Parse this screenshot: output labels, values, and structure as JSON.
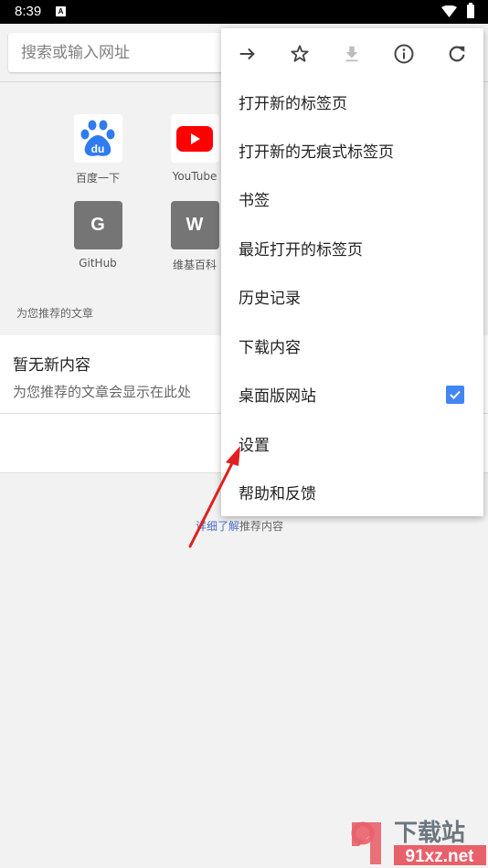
{
  "status_bar": {
    "time": "8:39",
    "notification_icon": "A",
    "icons": [
      "wifi-icon",
      "battery-charging-icon"
    ]
  },
  "address_bar": {
    "placeholder": "搜索或输入网址",
    "value": ""
  },
  "shortcuts": [
    {
      "label": "百度一下",
      "icon": "baidu-paw-icon"
    },
    {
      "label": "YouTube",
      "icon": "youtube-play-icon"
    },
    {
      "label": "GitHub",
      "icon": "letter-tile",
      "letter": "G"
    },
    {
      "label": "维基百科",
      "icon": "letter-tile",
      "letter": "W"
    }
  ],
  "articles": {
    "section_label": "为您推荐的文章",
    "empty_title": "暂无新内容",
    "empty_subtitle": "为您推荐的文章会显示在此处",
    "learn_more_link": "详细了解",
    "learn_more_suffix": "推荐内容"
  },
  "menu": {
    "top_icons": [
      {
        "name": "forward-icon",
        "enabled": true
      },
      {
        "name": "bookmark-star-icon",
        "enabled": true
      },
      {
        "name": "download-icon",
        "enabled": false
      },
      {
        "name": "info-icon",
        "enabled": true
      },
      {
        "name": "reload-icon",
        "enabled": true
      }
    ],
    "items": [
      {
        "label": "打开新的标签页"
      },
      {
        "label": "打开新的无痕式标签页"
      },
      {
        "label": "书签"
      },
      {
        "label": "最近打开的标签页"
      },
      {
        "label": "历史记录"
      },
      {
        "label": "下载内容"
      },
      {
        "label": "桌面版网站",
        "checked": true
      },
      {
        "label": "设置"
      },
      {
        "label": "帮助和反馈"
      }
    ]
  },
  "annotation": {
    "arrow_color": "#e02020",
    "points_to": "设置"
  },
  "watermark": {
    "logo_text": "91",
    "title": "下载站",
    "domain": "91xz.net"
  },
  "colors": {
    "accent": "#4285f4",
    "baidu_blue": "#2f7bf0",
    "youtube_red": "#ff0000",
    "tile_gray": "#757575",
    "watermark_red": "#e8606a"
  }
}
